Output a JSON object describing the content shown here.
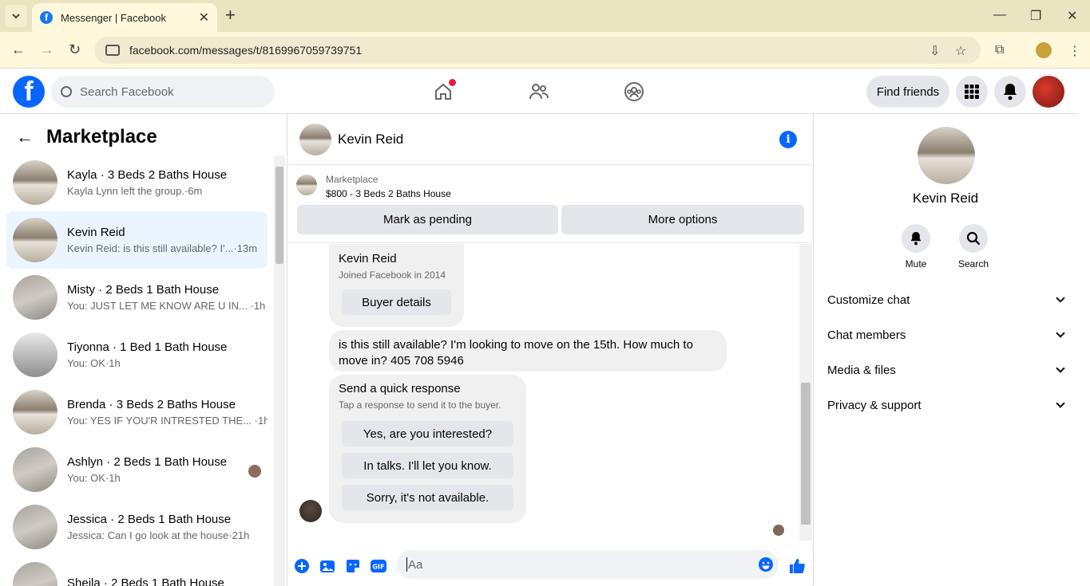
{
  "browser": {
    "tab_title": "Messenger | Facebook",
    "url": "facebook.com/messages/t/8169967059739751"
  },
  "fb": {
    "search_placeholder": "Search Facebook",
    "find_friends": "Find friends"
  },
  "left": {
    "title": "Marketplace",
    "conversations": [
      {
        "name": "Kayla · 3 Beds 2 Baths House",
        "preview": "Kayla Lynn left the group.·6m"
      },
      {
        "name": "Kevin Reid",
        "preview": "Kevin Reid: is this still available? I'...·13m"
      },
      {
        "name": "Misty · 2 Beds 1 Bath House",
        "preview": "You: JUST LET ME KNOW ARE U IN...  ·1h"
      },
      {
        "name": "Tiyonna · 1 Bed 1 Bath House",
        "preview": "You: OK·1h"
      },
      {
        "name": "Brenda · 3 Beds 2 Baths House",
        "preview": "You: YES IF YOU'R INTRESTED THE...  ·1h"
      },
      {
        "name": "Ashlyn · 2 Beds 1 Bath House",
        "preview": "You: OK·1h"
      },
      {
        "name": "Jessica · 2 Beds 1 Bath House",
        "preview": "Jessica: Can I go look at the house·21h"
      },
      {
        "name": "Sheila · 2 Beds 1 Bath House",
        "preview": ""
      }
    ]
  },
  "chat": {
    "name": "Kevin Reid",
    "marketplace_label": "Marketplace",
    "listing": "$800 - 3 Beds 2 Baths House",
    "mark_pending": "Mark as pending",
    "more_options": "More options",
    "buyer_card": {
      "name": "Kevin Reid",
      "joined": "Joined Facebook in 2014",
      "button": "Buyer details"
    },
    "message": "is this still available? I'm looking to move on the 15th. How much to move in? 405 708 5946",
    "quick": {
      "title": "Send a quick response",
      "subtitle": "Tap a response to send it to the buyer.",
      "options": [
        "Yes, are you interested?",
        "In talks. I'll let you know.",
        "Sorry, it's not available."
      ]
    },
    "composer_placeholder": "Aa"
  },
  "right": {
    "name": "Kevin Reid",
    "actions": [
      "Mute",
      "Search"
    ],
    "sections": [
      "Customize chat",
      "Chat members",
      "Media & files",
      "Privacy & support"
    ]
  },
  "colors": {
    "fb_blue": "#0866ff",
    "active_row": "#ebf5ff",
    "bubble": "#f0f0f0"
  }
}
